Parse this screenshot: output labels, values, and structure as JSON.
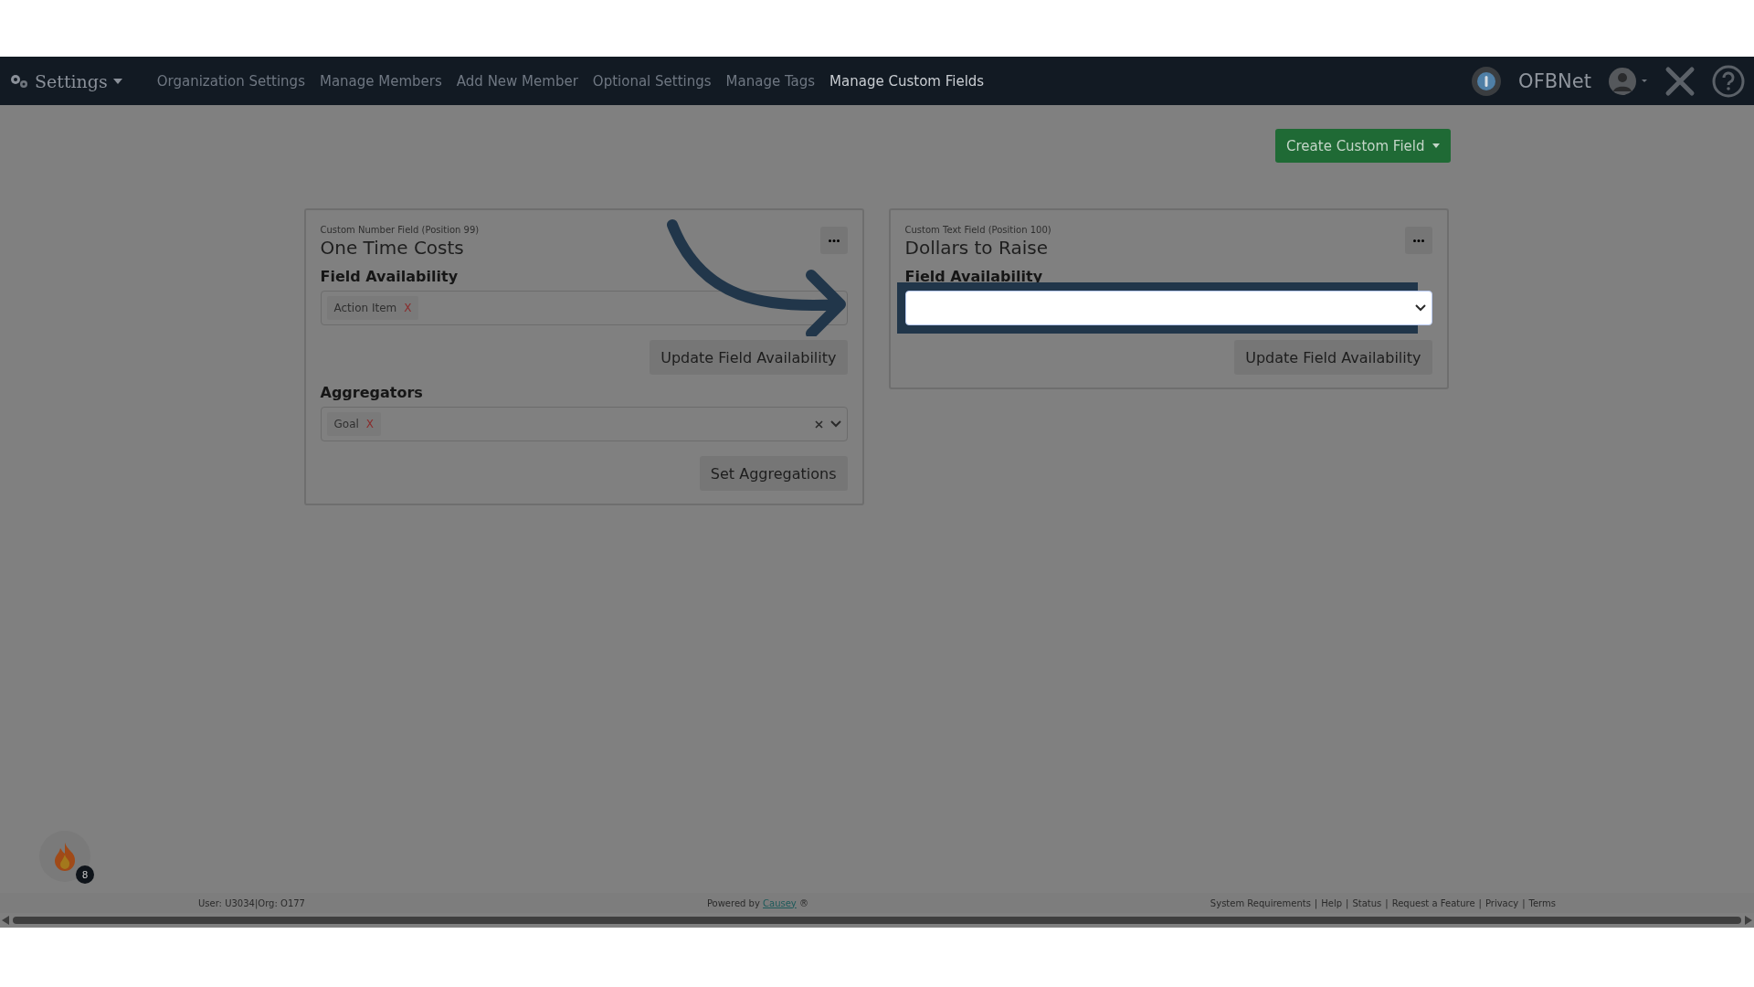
{
  "nav": {
    "brand": "Settings",
    "links": [
      {
        "label": "Organization Settings",
        "selected": false
      },
      {
        "label": "Manage Members",
        "selected": false
      },
      {
        "label": "Add New Member",
        "selected": false
      },
      {
        "label": "Optional Settings",
        "selected": false
      },
      {
        "label": "Manage Tags",
        "selected": false
      },
      {
        "label": "Manage Custom Fields",
        "selected": true
      }
    ],
    "org": "OFBNet"
  },
  "create_button": "Create Custom Field",
  "cards": [
    {
      "subtitle": "Custom Number Field (Position 99)",
      "title": "One Time Costs",
      "sections": [
        {
          "label": "Field Availability",
          "tags": [
            {
              "label": "Action Item",
              "remove": "X"
            }
          ],
          "clearable": false,
          "highlighted": false,
          "button": "Update Field Availability"
        },
        {
          "label": "Aggregators",
          "tags": [
            {
              "label": "Goal",
              "remove": "X"
            }
          ],
          "clearable": true,
          "highlighted": false,
          "button": "Set Aggregations"
        }
      ]
    },
    {
      "subtitle": "Custom Text Field (Position 100)",
      "title": "Dollars to Raise",
      "sections": [
        {
          "label": "Field Availability",
          "clearable": false,
          "highlighted": true,
          "button": "Update Field Availability"
        }
      ]
    }
  ],
  "notification_count": "8",
  "footer": {
    "user": "User: U3034|Org: O177",
    "powered_prefix": "Powered by",
    "powered_link": "Causey",
    "powered_suffix": "®",
    "separator": "|",
    "links": [
      "System Requirements",
      "Help",
      "Status",
      "Request a Feature",
      "Privacy",
      "Terms"
    ]
  }
}
